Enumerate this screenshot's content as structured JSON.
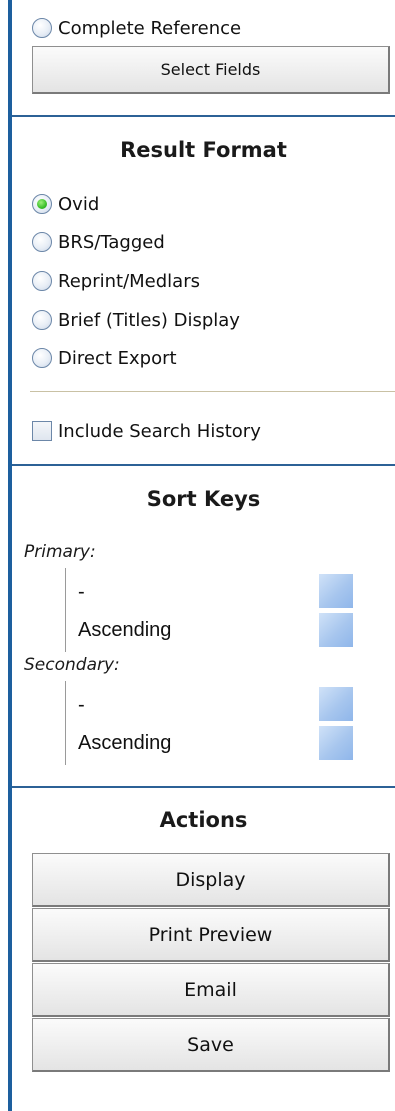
{
  "fields": {
    "complete_reference_label": "Complete Reference",
    "select_fields_label": "Select Fields"
  },
  "result_format": {
    "heading": "Result Format",
    "options": [
      {
        "label": "Ovid",
        "checked": true
      },
      {
        "label": "BRS/Tagged",
        "checked": false
      },
      {
        "label": "Reprint/Medlars",
        "checked": false
      },
      {
        "label": "Brief (Titles) Display",
        "checked": false
      },
      {
        "label": "Direct Export",
        "checked": false
      }
    ],
    "include_search_history_label": "Include Search History"
  },
  "sort_keys": {
    "heading": "Sort Keys",
    "primary_label": "Primary:",
    "primary_field": "-",
    "primary_order": "Ascending",
    "secondary_label": "Secondary:",
    "secondary_field": "-",
    "secondary_order": "Ascending"
  },
  "actions": {
    "heading": "Actions",
    "display_label": "Display",
    "print_preview_label": "Print Preview",
    "email_label": "Email",
    "save_label": "Save"
  },
  "colors": {
    "left_bar": "#1d5f9e",
    "divider": "#2c6196",
    "radio_checked": "#3cbf2a"
  }
}
